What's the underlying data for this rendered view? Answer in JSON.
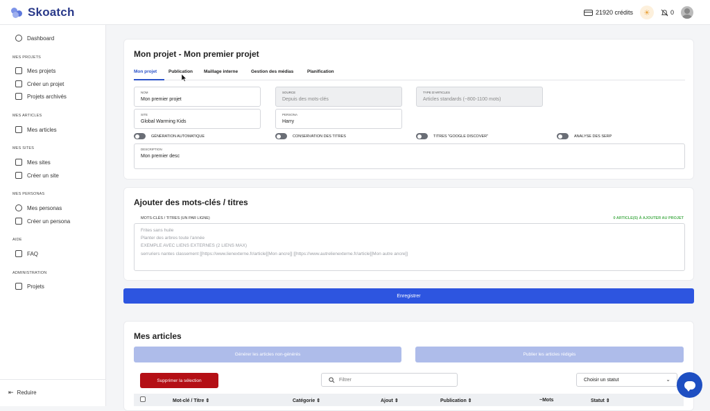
{
  "app": {
    "name": "Skoatch"
  },
  "topbar": {
    "credits": "21920 crédits",
    "notifications": "0"
  },
  "sidebar": {
    "dashboard": "Dashboard",
    "section_projects": "MES PROJETS",
    "projects": [
      "Mes projets",
      "Créer un projet",
      "Projets archivés"
    ],
    "section_articles": "MES ARTICLES",
    "articles": [
      "Mes articles"
    ],
    "section_sites": "MES SITES",
    "sites": [
      "Mes sites",
      "Créer un site"
    ],
    "section_personas": "MES PERSONAS",
    "personas": [
      "Mes personas",
      "Créer un persona"
    ],
    "section_help": "AIDE",
    "help": [
      "FAQ"
    ],
    "section_admin": "ADMINISTRATION",
    "admin": [
      "Projets"
    ],
    "reduce": "Reduire"
  },
  "project": {
    "title": "Mon projet - Mon premier projet",
    "tabs": [
      "Mon projet",
      "Publication",
      "Maillage interne",
      "Gestion des médias",
      "Planification"
    ],
    "fields": {
      "nom_label": "NOM",
      "nom_value": "Mon premier projet",
      "source_label": "SOURCE",
      "source_value": "Depuis des mots-clés",
      "type_label": "TYPE D'ARTICLES",
      "type_value": "Articles standards (~800-1100 mots)",
      "site_label": "SITE",
      "site_value": "Global Warming Kids",
      "persona_label": "PERSONA",
      "persona_value": "Harry",
      "description_label": "DESCRIPTION",
      "description_value": "Mon premier desc"
    },
    "toggles": [
      "GÉNÉRATION AUTOMATIQUE",
      "CONSERVATION DES TITRES",
      "TITRES \"GOOGLE DISCOVER\"",
      "ANALYSE DES SERP"
    ]
  },
  "keywords": {
    "title": "Ajouter des mots-clés / titres",
    "label": "MOTS-CLÉS / TITRES (UN PAR LIGNE)",
    "count": "0 ARTICLE(S) À AJOUTER AU PROJET",
    "lines": [
      "Frites sans huile",
      "Planter des arbres toute l'année",
      "EXEMPLE AVEC LIENS EXTERNES (2 LIENS MAX)",
      "serruriers nantes classement [[https://www.lienexterne.fr/article][Mon ancre]] [[https://www.autrelienexterne.fr/article][Mon autre ancre]]"
    ],
    "save": "Enregistrer"
  },
  "articles": {
    "title": "Mes articles",
    "generate": "Générer les articles non-générés",
    "publish": "Publier les articles rédigés",
    "delete": "Supprimer la sélection",
    "filter_placeholder": "Filtrer",
    "status_select": "Choisir un statut",
    "columns": [
      "Mot-clé / Titre ⇕",
      "Catégorie ⇕",
      "Ajout ⇕",
      "Publication ⇕",
      "~Mots",
      "Statut ⇕"
    ]
  }
}
